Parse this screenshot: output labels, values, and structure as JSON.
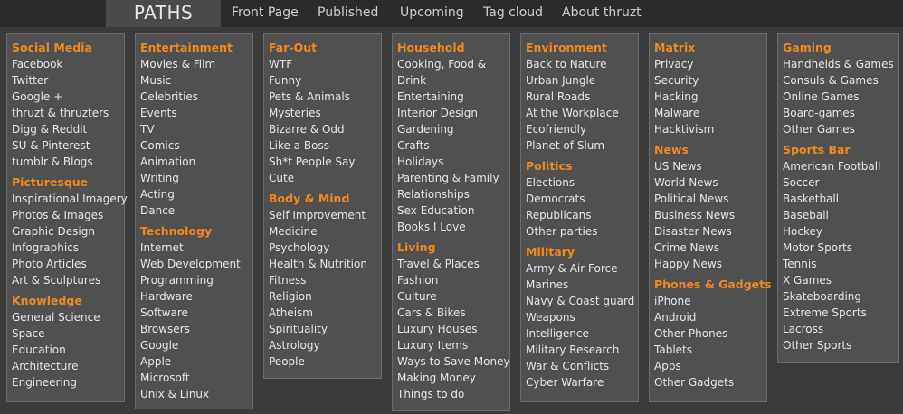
{
  "app": {
    "logo": "PATHS"
  },
  "nav": [
    "Front Page",
    "Published",
    "Upcoming",
    "Tag cloud",
    "About thruzt"
  ],
  "columns": [
    {
      "sections": [
        {
          "title": "Social Media",
          "items": [
            "Facebook",
            "Twitter",
            "Google +",
            "thruzt & thruzters",
            "Digg & Reddit",
            "SU & Pinterest",
            "tumblr & Blogs"
          ]
        },
        {
          "title": "Picturesque",
          "items": [
            "Inspirational Imagery",
            "Photos & Images",
            "Graphic Design",
            "Infographics",
            "Photo Articles",
            "Art & Sculptures"
          ]
        },
        {
          "title": "Knowledge",
          "items": [
            "General Science",
            "Space",
            "Education",
            "Architecture",
            "Engineering"
          ]
        }
      ]
    },
    {
      "sections": [
        {
          "title": "Entertainment",
          "items": [
            "Movies & Film",
            "Music",
            "Celebrities",
            "Events",
            "TV",
            "Comics",
            "Animation",
            "Writing",
            "Acting",
            "Dance"
          ]
        },
        {
          "title": "Technology",
          "items": [
            "Internet",
            "Web Development",
            "Programming",
            "Hardware",
            "Software",
            "Browsers",
            "Google",
            "Apple",
            "Microsoft",
            "Unix & Linux"
          ]
        }
      ]
    },
    {
      "sections": [
        {
          "title": "Far-Out",
          "items": [
            "WTF",
            "Funny",
            "Pets & Animals",
            "Mysteries",
            "Bizarre & Odd",
            "Like a Boss",
            "Sh*t People Say",
            "Cute"
          ]
        },
        {
          "title": "Body & Mind",
          "items": [
            "Self Improvement",
            "Medicine",
            "Psychology",
            "Health & Nutrition",
            "Fitness",
            "Religion",
            "Atheism",
            "Spirituality",
            "Astrology",
            "People"
          ]
        }
      ]
    },
    {
      "sections": [
        {
          "title": "Household",
          "items": [
            "Cooking, Food &",
            "Drink",
            "Entertaining",
            "Interior Design",
            "Gardening",
            "Crafts",
            "Holidays",
            "Parenting & Family",
            "Relationships",
            "Sex Education",
            "Books I Love"
          ]
        },
        {
          "title": "Living",
          "items": [
            "Travel & Places",
            "Fashion",
            "Culture",
            "Cars & Bikes",
            "Luxury Houses",
            "Luxury Items",
            "Ways to Save Money",
            "Making Money",
            "Things to do"
          ]
        }
      ]
    },
    {
      "sections": [
        {
          "title": "Environment",
          "items": [
            "Back to Nature",
            "Urban Jungle",
            "Rural Roads",
            "At the Workplace",
            "Ecofriendly",
            "Planet of Slum"
          ]
        },
        {
          "title": "Politics",
          "items": [
            "Elections",
            "Democrats",
            "Republicans",
            "Other parties"
          ]
        },
        {
          "title": "Military",
          "items": [
            "Army & Air Force",
            "Marines",
            "Navy & Coast guard",
            "Weapons",
            "Intelligence",
            "Military Research",
            "War & Conflicts",
            "Cyber Warfare"
          ]
        }
      ]
    },
    {
      "sections": [
        {
          "title": "Matrix",
          "items": [
            "Privacy",
            "Security",
            "Hacking",
            "Malware",
            "Hacktivism"
          ]
        },
        {
          "title": "News",
          "items": [
            "US News",
            "World News",
            "Political News",
            "Business News",
            "Disaster News",
            "Crime News",
            "Happy News"
          ]
        },
        {
          "title": "Phones & Gadgets",
          "items": [
            "iPhone",
            "Android",
            "Other Phones",
            "Tablets",
            "Apps",
            "Other Gadgets"
          ]
        }
      ]
    },
    {
      "sections": [
        {
          "title": "Gaming",
          "items": [
            "Handhelds & Games",
            "Consuls & Games",
            "Online Games",
            "Board-games",
            "Other Games"
          ]
        },
        {
          "title": "Sports Bar",
          "items": [
            "American Football",
            "Soccer",
            "Basketball",
            "Baseball",
            "Hockey",
            "Motor Sports",
            "Tennis",
            "X Games",
            "Skateboarding",
            "Extreme Sports",
            "Lacross",
            "Other Sports"
          ]
        }
      ]
    }
  ],
  "colors": {
    "accent": "#f08a1e",
    "panel": "#505050",
    "text": "#e6e6e6",
    "topbar": "#2b2b2b"
  }
}
